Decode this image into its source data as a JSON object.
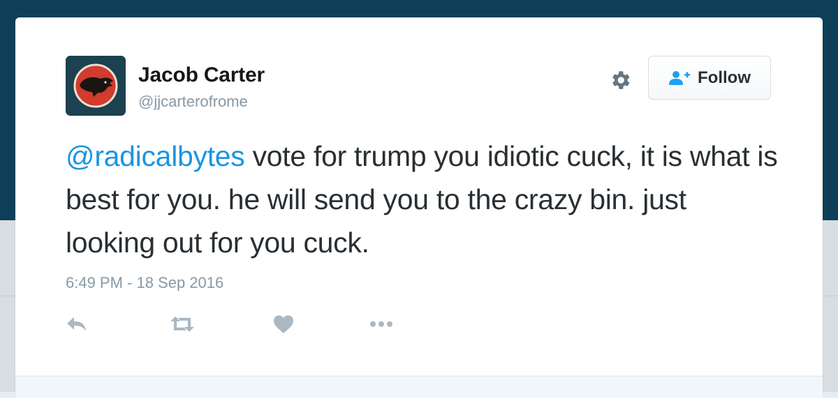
{
  "tweet": {
    "author_name": "Jacob Carter",
    "author_handle": "@jjcarterofrome",
    "mention": "@radicalbytes",
    "text_rest": " vote for trump you idiotic cuck, it is what is best for you. he will send you to the crazy bin. just looking out for you cuck.",
    "timestamp": "6:49 PM - 18 Sep 2016"
  },
  "header": {
    "follow_label": "Follow",
    "gear_icon": "gear-icon",
    "follow_icon": "add-user-icon"
  },
  "actions": [
    {
      "icon": "reply-icon"
    },
    {
      "icon": "retweet-icon"
    },
    {
      "icon": "heart-icon"
    },
    {
      "icon": "more-icon"
    }
  ],
  "colors": {
    "background_top": "#0d4058",
    "link": "#1b95e0",
    "text": "#292f33",
    "muted": "#8899a6",
    "action_icon": "#aab8c2",
    "follow_icon": "#1da1f2"
  }
}
